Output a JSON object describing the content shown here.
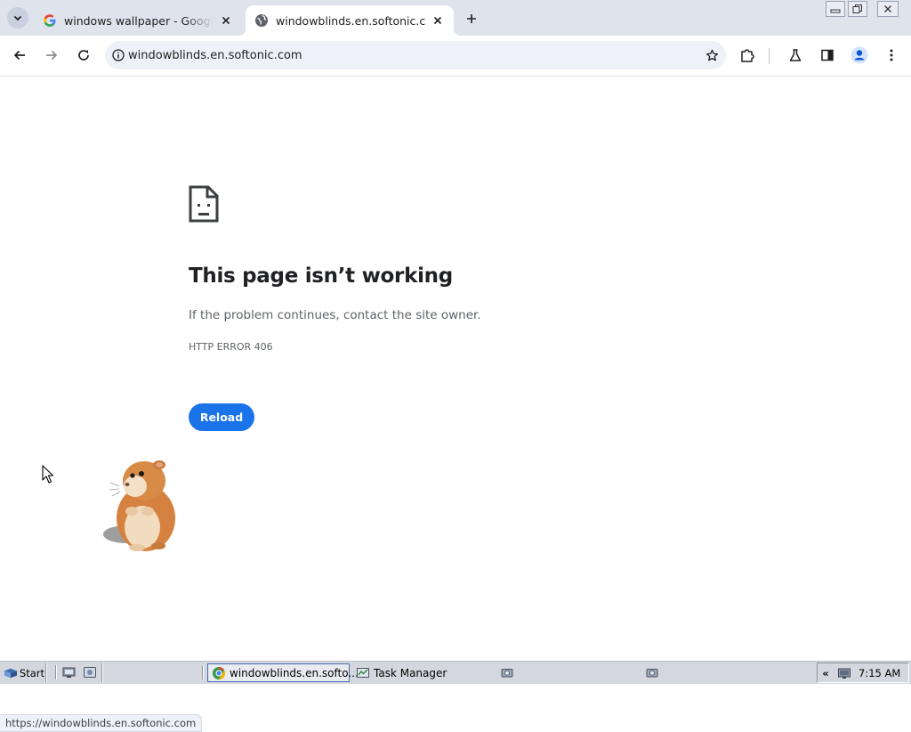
{
  "browser": {
    "tabs": [
      {
        "title": "windows wallpaper - Google Search",
        "active": false
      },
      {
        "title": "windowblinds.en.softonic.com",
        "active": true
      }
    ],
    "address_bar": {
      "url": "windowblinds.en.softonic.com"
    },
    "status_url": "https://windowblinds.en.softonic.com"
  },
  "page": {
    "error_title": "This page isn’t working",
    "error_message": "If the problem continues, contact the site owner.",
    "error_code": "HTTP ERROR 406",
    "reload_label": "Reload"
  },
  "taskbar": {
    "start_label": "Start",
    "tasks": [
      {
        "label": "windowblinds.en.softo...",
        "active": true
      },
      {
        "label": "Task Manager",
        "active": false
      }
    ],
    "tray_arrows": "«",
    "clock": "7:15 AM"
  },
  "colors": {
    "tab_strip": "#dfe3ec",
    "omnibox": "#eef1f8",
    "reload_button": "#1a73e8",
    "taskbar": "#d4d8de"
  }
}
